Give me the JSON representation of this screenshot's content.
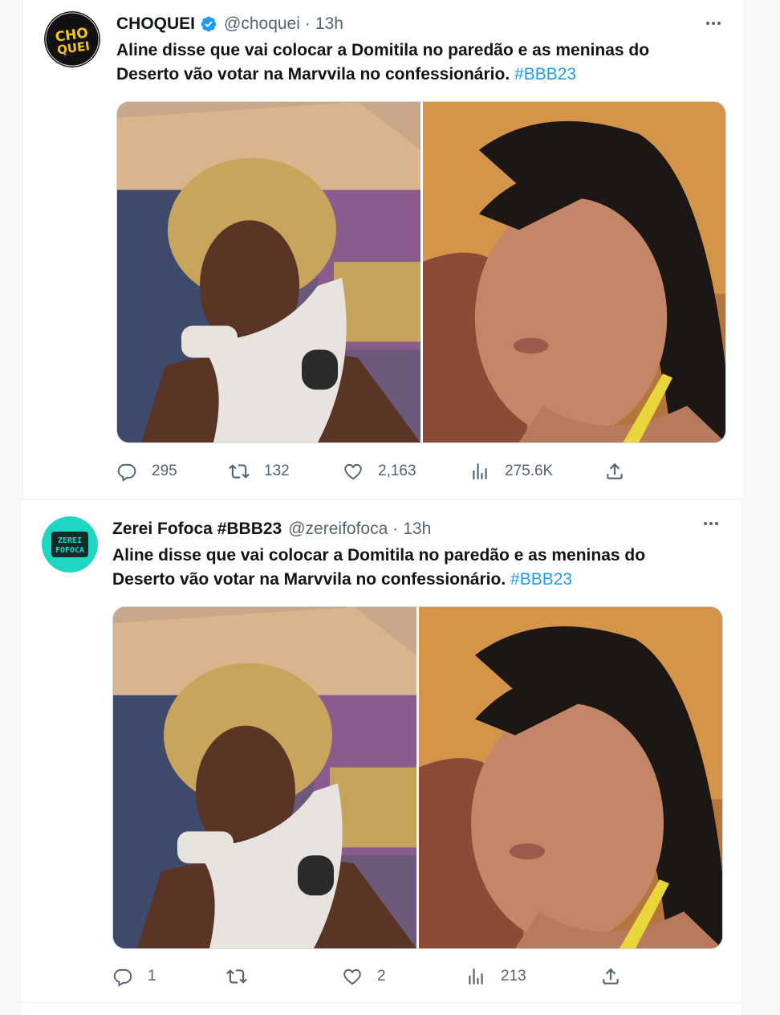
{
  "tweets": [
    {
      "display_name": "CHOQUEI",
      "verified": true,
      "handle": "@choquei",
      "dot": "·",
      "time": "13h",
      "avatar_text_line1": "CHO",
      "avatar_text_line2": "QUEI",
      "avatar_colors": {
        "bg": "#111111",
        "text": "#f5c518"
      },
      "text": "Aline disse que vai colocar a Domitila no paredão e as meninas do Deserto vão votar na Marvvila no confessionário.",
      "hashtag": "#BBB23",
      "stats": {
        "replies": "295",
        "retweets": "132",
        "likes": "2,163",
        "views": "275.6K"
      }
    },
    {
      "display_name": "Zerei Fofoca #BBB23",
      "verified": false,
      "handle": "@zereifofoca",
      "dot": "·",
      "time": "13h",
      "avatar_text_line1": "ZEREI",
      "avatar_text_line2": "FOFOCA",
      "avatar_colors": {
        "bg": "#1fd6c3",
        "text": "#1fd6c3"
      },
      "text": "Aline disse que vai colocar a Domitila no paredão e as meninas do Deserto vão votar na Marvvila no confessionário.",
      "hashtag": "#BBB23",
      "stats": {
        "replies": "1",
        "retweets": "",
        "likes": "2",
        "views": "213"
      }
    }
  ],
  "icons": {
    "more": "more-horizontal-icon",
    "reply": "reply-icon",
    "retweet": "retweet-icon",
    "like": "heart-icon",
    "views": "views-bar-chart-icon",
    "share": "share-icon"
  },
  "colors": {
    "accent": "#1d9bf0",
    "muted": "#536471",
    "text": "#0f1419"
  }
}
